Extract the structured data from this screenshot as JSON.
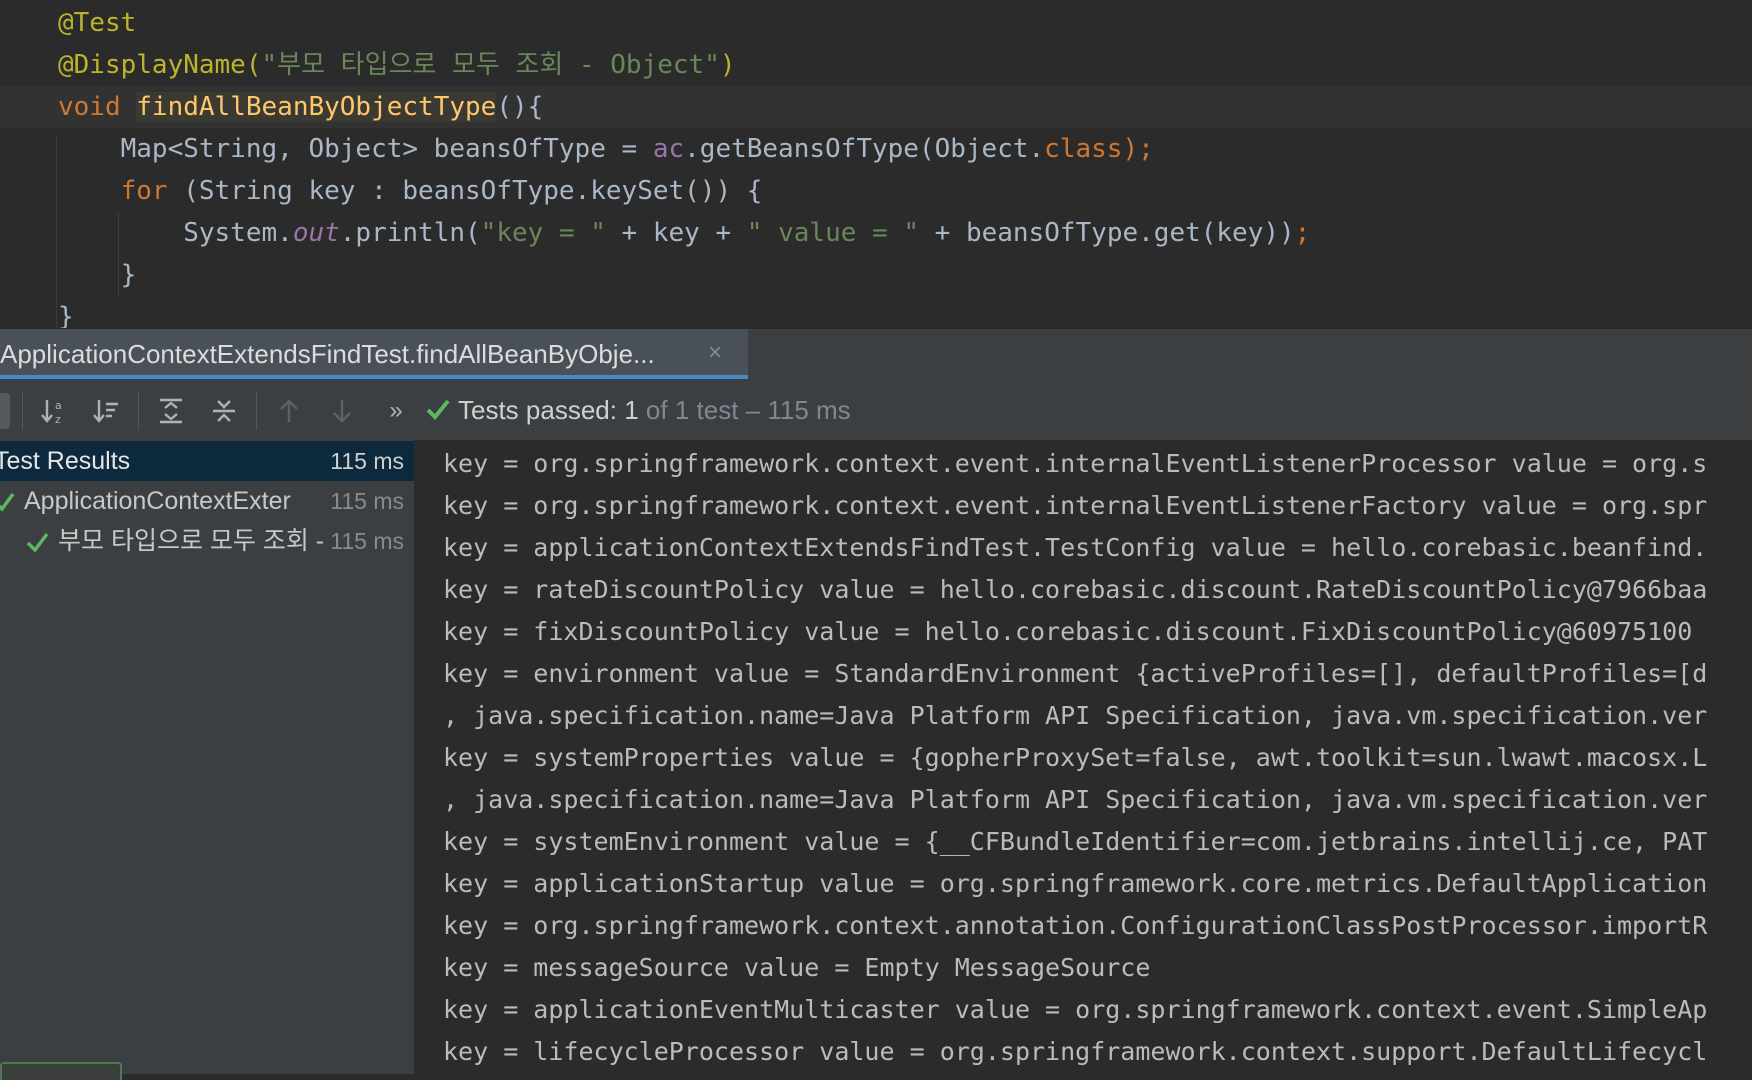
{
  "editor": {
    "lines": [
      {
        "parts": [
          {
            "t": "@Test",
            "c": "t-ann"
          }
        ]
      },
      {
        "parts": [
          {
            "t": "@DisplayName(",
            "c": "t-ann"
          },
          {
            "t": "\"부모 타입으로 모두 조회 - Object\"",
            "c": "t-str"
          },
          {
            "t": ")",
            "c": "t-ann"
          }
        ]
      },
      {
        "current": true,
        "parts": [
          {
            "t": "void ",
            "c": "t-kw"
          },
          {
            "t": "findAllBeanByObjectType",
            "c": "t-fnhl"
          },
          {
            "t": "(){",
            "c": ""
          }
        ]
      },
      {
        "parts": [
          {
            "t": "    Map<String, Object> beansOfType = ",
            "c": ""
          },
          {
            "t": "ac",
            "c": "t-field-plain"
          },
          {
            "t": ".getBeansOfType(Object.",
            "c": ""
          },
          {
            "t": "class",
            "c": "t-kw"
          },
          {
            "t": ");",
            "c": "t-kw"
          }
        ]
      },
      {
        "parts": [
          {
            "t": "    ",
            "c": ""
          },
          {
            "t": "for",
            "c": "t-kw"
          },
          {
            "t": " (String key : beansOfType.keySet()) {",
            "c": ""
          }
        ]
      },
      {
        "parts": [
          {
            "t": "        System.",
            "c": ""
          },
          {
            "t": "out",
            "c": "t-field"
          },
          {
            "t": ".println(",
            "c": ""
          },
          {
            "t": "\"key = \"",
            "c": "t-str"
          },
          {
            "t": " + key + ",
            "c": ""
          },
          {
            "t": "\" value = \"",
            "c": "t-str"
          },
          {
            "t": " + beansOfType.get(key))",
            "c": ""
          },
          {
            "t": ";",
            "c": "t-kw"
          }
        ]
      },
      {
        "parts": [
          {
            "t": "    }",
            "c": ""
          }
        ]
      },
      {
        "parts": [
          {
            "t": "}",
            "c": ""
          }
        ]
      }
    ]
  },
  "run_tab": {
    "title": "ApplicationContextExtendsFindTest.findAllBeanByObje...",
    "close": "×"
  },
  "toolbar": {
    "status_passed": "Tests passed:",
    "status_count": "1",
    "status_rest": "of 1 test – 115 ms",
    "more": "»"
  },
  "test_tree": {
    "root": {
      "label": "Test Results",
      "time": "115 ms"
    },
    "class": {
      "label": "ApplicationContextExter",
      "time": "115 ms"
    },
    "method": {
      "label": "부모 타입으로 모두 조회 -",
      "time": "115 ms"
    }
  },
  "console": {
    "lines": [
      "key = org.springframework.context.event.internalEventListenerProcessor value = org.s",
      "key = org.springframework.context.event.internalEventListenerFactory value = org.spr",
      "key = applicationContextExtendsFindTest.TestConfig value = hello.corebasic.beanfind.",
      "key = rateDiscountPolicy value = hello.corebasic.discount.RateDiscountPolicy@7966baa",
      "key = fixDiscountPolicy value = hello.corebasic.discount.FixDiscountPolicy@60975100",
      "key = environment value = StandardEnvironment {activeProfiles=[], defaultProfiles=[d",
      ", java.specification.name=Java Platform API Specification, java.vm.specification.ver",
      "key = systemProperties value = {gopherProxySet=false, awt.toolkit=sun.lwawt.macosx.L",
      ", java.specification.name=Java Platform API Specification, java.vm.specification.ver",
      "key = systemEnvironment value = {__CFBundleIdentifier=com.jetbrains.intellij.ce, PAT",
      "key = applicationStartup value = org.springframework.core.metrics.DefaultApplication",
      "key = org.springframework.context.annotation.ConfigurationClassPostProcessor.importR",
      "key = messageSource value = Empty MessageSource",
      "key = applicationEventMulticaster value = org.springframework.context.event.SimpleAp",
      "key = lifecycleProcessor value = org.springframework.context.support.DefaultLifecycl"
    ]
  },
  "colors": {
    "editor_bg": "#2b2b2b",
    "panel_bg": "#3c3f41",
    "selection": "#0d293e",
    "pass_green": "#5fb85f",
    "tab_accent": "#4a88c7"
  },
  "icons": [
    "sort-alpha-icon",
    "sort-duration-icon",
    "expand-all-icon",
    "collapse-all-icon",
    "prev-failed-icon",
    "next-failed-icon",
    "more-icon",
    "check-icon"
  ]
}
